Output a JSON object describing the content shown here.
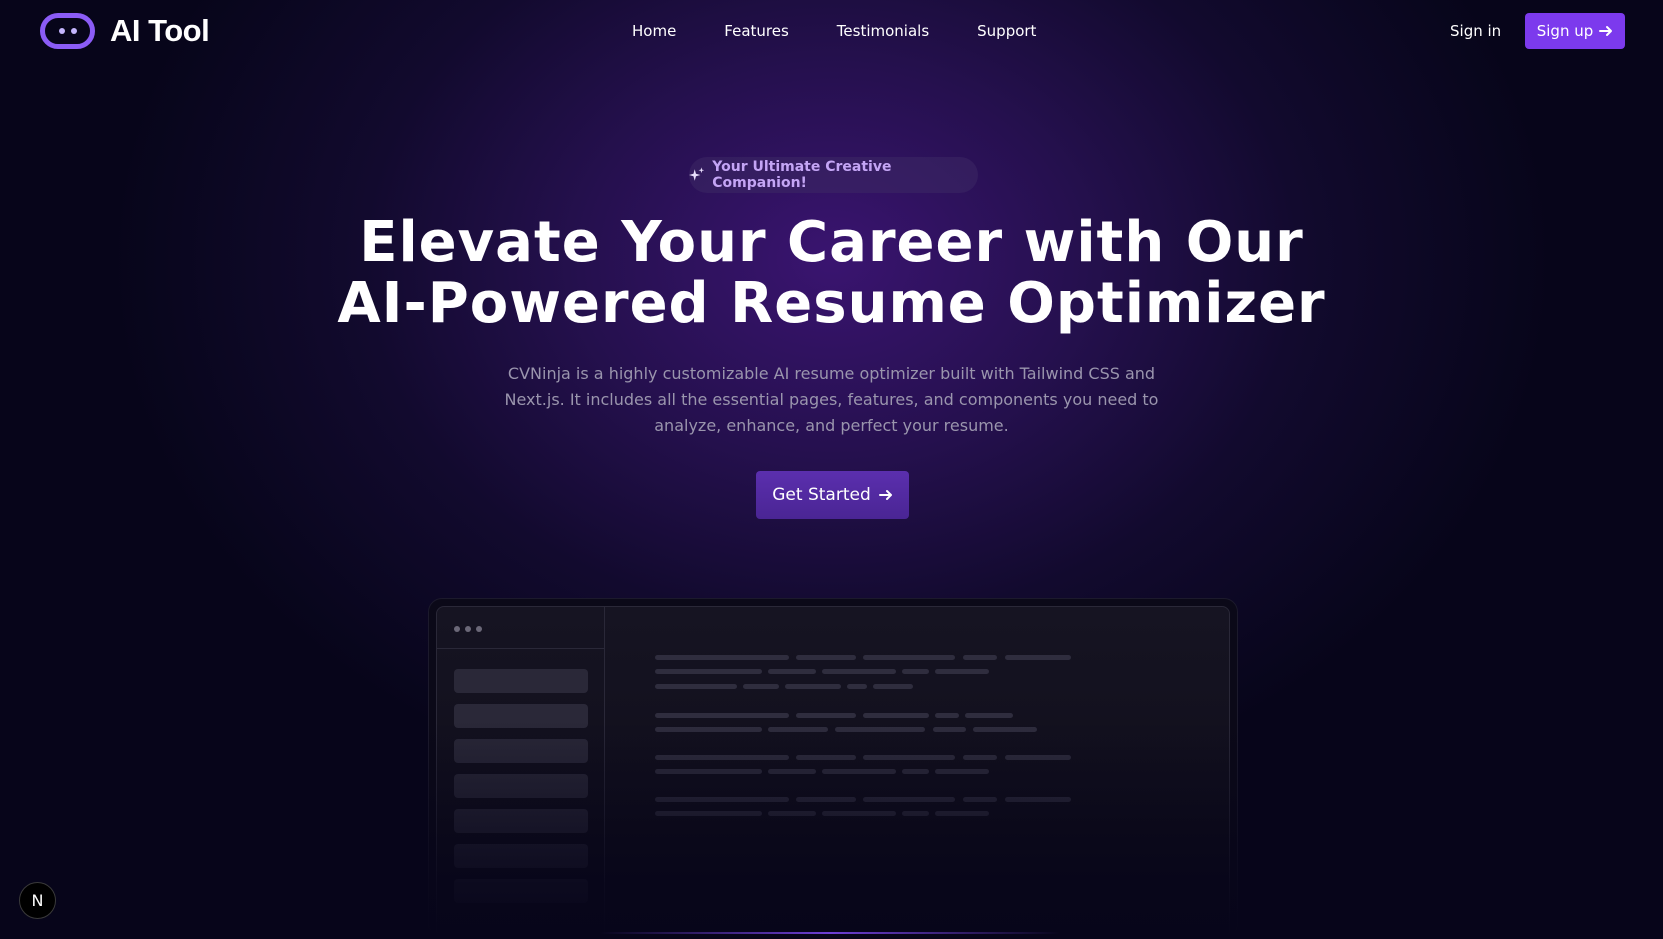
{
  "nav": {
    "logo_text": "AI Tool",
    "links": [
      "Home",
      "Features",
      "Testimonials",
      "Support"
    ],
    "sign_in": "Sign in",
    "sign_up": "Sign up"
  },
  "hero": {
    "badge": "Your Ultimate Creative Companion!",
    "title_line1": "Elevate Your Career with Our",
    "title_line2": "AI-Powered Resume Optimizer",
    "description": "CVNinja is a highly customizable AI resume optimizer built with Tailwind CSS and Next.js. It includes all the essential pages, features, and components you need to analyze, enhance, and perfect your resume.",
    "cta": "Get Started"
  },
  "footer_badge": "N",
  "colors": {
    "accent": "#7c3aed",
    "background": "#07051a",
    "badge_text": "#c4a5f5"
  },
  "icons": {
    "badge": "sparkle-icon",
    "arrow": "arrow-right-icon"
  }
}
